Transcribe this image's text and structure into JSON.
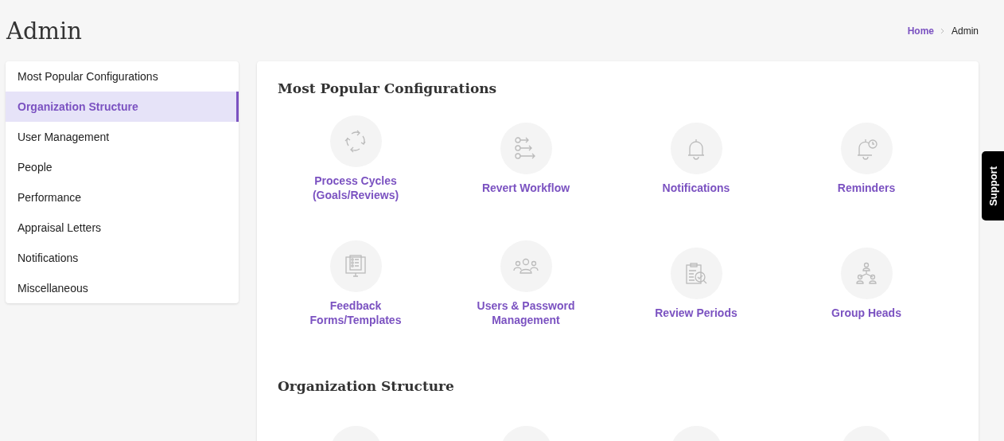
{
  "page_title": "Admin",
  "breadcrumb": [
    {
      "label": "Home",
      "kind": "link"
    },
    {
      "label": "Admin",
      "kind": "current"
    }
  ],
  "sidebar": {
    "items": [
      {
        "label": "Most Popular Configurations",
        "selected": false
      },
      {
        "label": "Organization Structure",
        "selected": true
      },
      {
        "label": "User Management",
        "selected": false
      },
      {
        "label": "People",
        "selected": false
      },
      {
        "label": "Performance",
        "selected": false
      },
      {
        "label": "Appraisal Letters",
        "selected": false
      },
      {
        "label": "Notifications",
        "selected": false
      },
      {
        "label": "Miscellaneous",
        "selected": false
      }
    ]
  },
  "sections": [
    {
      "title": "Most Popular Configurations",
      "items": [
        {
          "label": "Process Cycles (Goals/Reviews)",
          "kind": "tile"
        },
        {
          "label": "Revert Workflow",
          "kind": "tile"
        },
        {
          "label": "Notifications",
          "kind": "tile"
        },
        {
          "label": "Reminders",
          "kind": "tile"
        },
        {
          "label": "Feedback Forms/Templates",
          "kind": "tile"
        },
        {
          "label": "Users & Password Management",
          "kind": "tile"
        },
        {
          "label": "Review Periods",
          "kind": "tile"
        },
        {
          "label": "Group Heads",
          "kind": "tile"
        }
      ]
    },
    {
      "title": "Organization Structure",
      "items": [
        {
          "kind": "cut"
        },
        {
          "kind": "cut"
        },
        {
          "kind": "cut"
        },
        {
          "kind": "cut"
        }
      ]
    }
  ],
  "support_tab": "Support"
}
